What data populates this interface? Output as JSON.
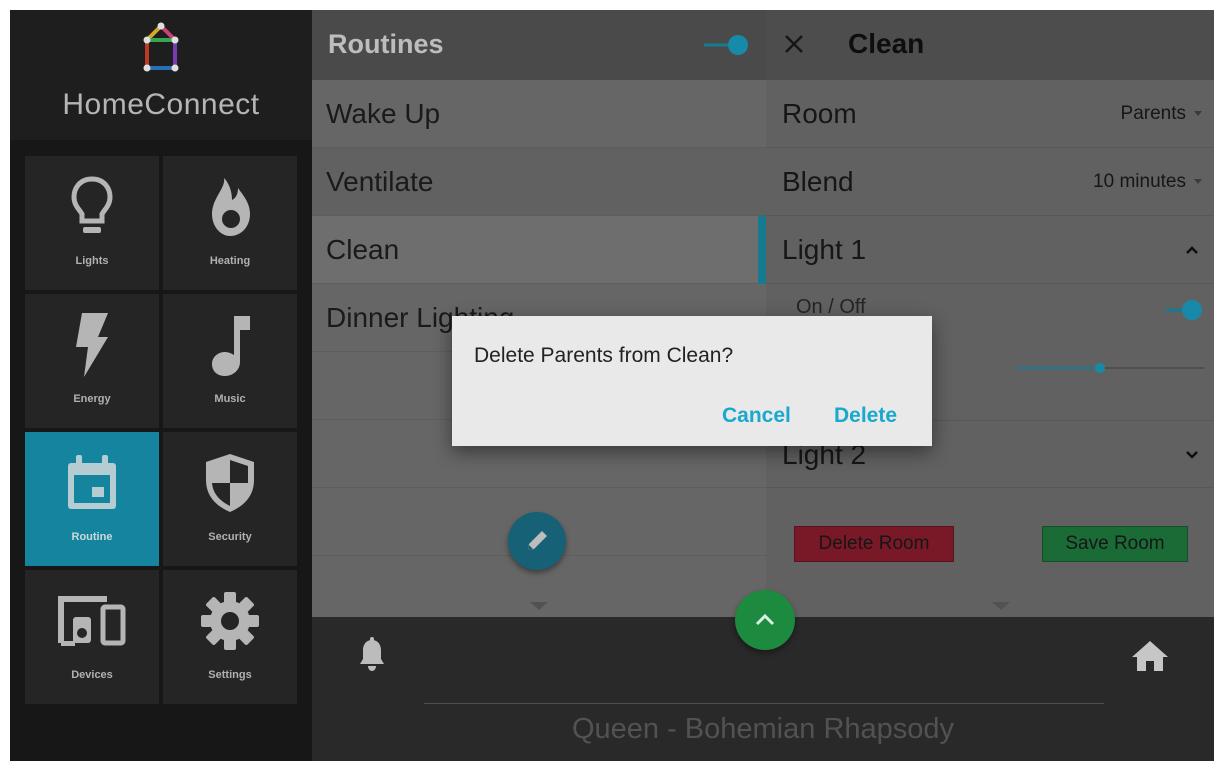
{
  "brand": {
    "name": "HomeConnect",
    "logo_icon": "house-logo-icon"
  },
  "sidebar": {
    "tiles": [
      {
        "label": "Lights",
        "icon": "lightbulb-icon",
        "active": false
      },
      {
        "label": "Heating",
        "icon": "flame-icon",
        "active": false
      },
      {
        "label": "Energy",
        "icon": "lightning-icon",
        "active": false
      },
      {
        "label": "Music",
        "icon": "music-note-icon",
        "active": false
      },
      {
        "label": "Routine",
        "icon": "calendar-icon",
        "active": true
      },
      {
        "label": "Security",
        "icon": "shield-icon",
        "active": false
      },
      {
        "label": "Devices",
        "icon": "devices-icon",
        "active": false
      },
      {
        "label": "Settings",
        "icon": "gear-icon",
        "active": false
      }
    ]
  },
  "routines": {
    "title": "Routines",
    "items": [
      "Wake Up",
      "Ventilate",
      "Clean",
      "Dinner Lighting"
    ],
    "selected": "Clean"
  },
  "detail": {
    "title": "Clean",
    "room_label": "Room",
    "room_value": "Parents",
    "blend_label": "Blend",
    "blend_value": "10 minutes",
    "light1_label": "Light 1",
    "onoff_label": "On / Off",
    "light2_label": "Light 2",
    "delete_room_label": "Delete Room",
    "save_room_label": "Save Room"
  },
  "dialog": {
    "message": "Delete Parents from Clean?",
    "cancel_label": "Cancel",
    "delete_label": "Delete"
  },
  "player": {
    "now_playing": "Queen - Bohemian Rhapsody"
  },
  "colors": {
    "accent": "#1897b4",
    "save": "#1f7a3e",
    "delete": "#8a1d2e",
    "dialog_button": "#18a9cc"
  }
}
